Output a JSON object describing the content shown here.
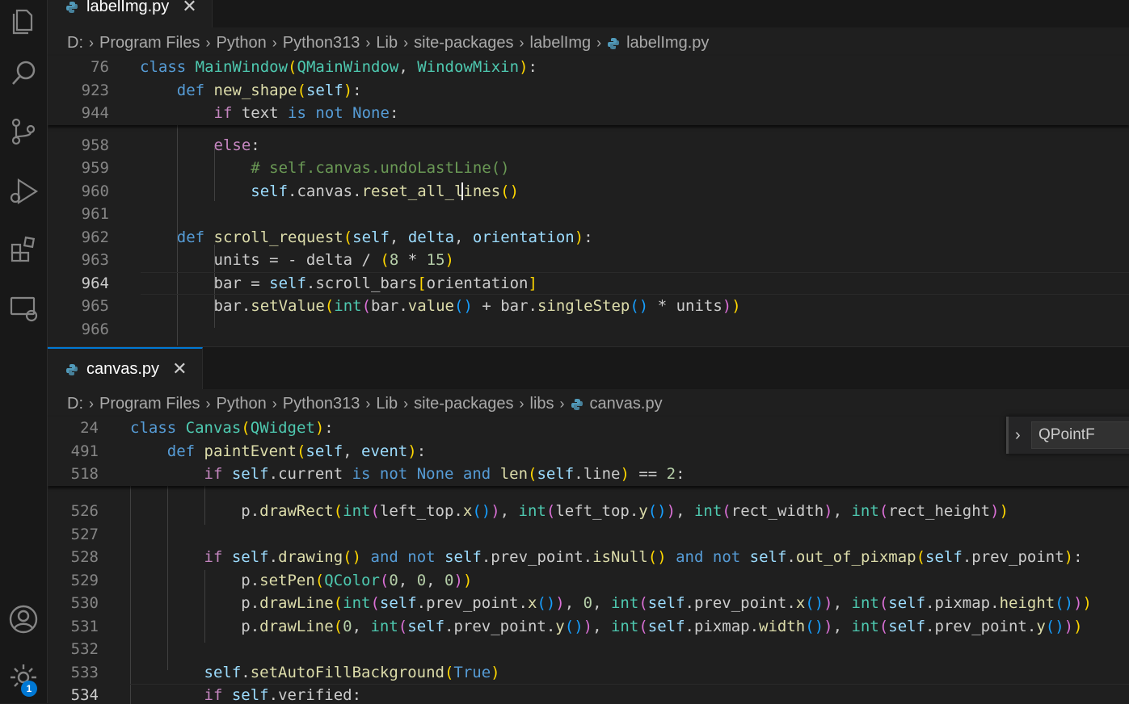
{
  "activity_bar": {
    "icons": [
      "explorer-icon",
      "search-icon",
      "source-control-icon",
      "run-debug-icon",
      "extensions-icon",
      "remote-explorer-icon",
      "accounts-icon",
      "manage-gear-icon"
    ],
    "badge": "1"
  },
  "top_pane": {
    "tab": {
      "label": "labelImg.py",
      "close": "✕"
    },
    "breadcrumb": [
      "D:",
      "Program Files",
      "Python",
      "Python313",
      "Lib",
      "site-packages",
      "labelImg",
      "labelImg.py"
    ],
    "sticky": [
      {
        "num": "76",
        "code": "class MainWindow(QMainWindow, WindowMixin):"
      },
      {
        "num": "923",
        "code": "    def new_shape(self):"
      },
      {
        "num": "944",
        "code": "        if text is not None:"
      }
    ],
    "lines": [
      {
        "num": "958",
        "code": "        else:"
      },
      {
        "num": "959",
        "code": "            # self.canvas.undoLastLine()"
      },
      {
        "num": "960",
        "code": "            self.canvas.reset_all_lines()"
      },
      {
        "num": "961",
        "code": ""
      },
      {
        "num": "962",
        "code": "    def scroll_request(self, delta, orientation):"
      },
      {
        "num": "963",
        "code": "        units = - delta / (8 * 15)"
      },
      {
        "num": "964",
        "code": "        bar = self.scroll_bars[orientation]"
      },
      {
        "num": "965",
        "code": "        bar.setValue(int(bar.value() + bar.singleStep() * units))"
      },
      {
        "num": "966",
        "code": ""
      }
    ]
  },
  "bottom_pane": {
    "tab": {
      "label": "canvas.py",
      "close": "✕"
    },
    "breadcrumb": [
      "D:",
      "Program Files",
      "Python",
      "Python313",
      "Lib",
      "site-packages",
      "libs",
      "canvas.py"
    ],
    "find_widget": {
      "value": "QPointF"
    },
    "sticky": [
      {
        "num": "24",
        "code": "class Canvas(QWidget):"
      },
      {
        "num": "491",
        "code": "    def paintEvent(self, event):"
      },
      {
        "num": "518",
        "code": "        if self.current is not None and len(self.line) == 2:"
      }
    ],
    "lines": [
      {
        "num": "526",
        "code": "            p.drawRect(int(left_top.x()), int(left_top.y()), int(rect_width), int(rect_height))"
      },
      {
        "num": "527",
        "code": ""
      },
      {
        "num": "528",
        "code": "        if self.drawing() and not self.prev_point.isNull() and not self.out_of_pixmap(self.prev_point):"
      },
      {
        "num": "529",
        "code": "            p.setPen(QColor(0, 0, 0))"
      },
      {
        "num": "530",
        "code": "            p.drawLine(int(self.prev_point.x()), 0, int(self.prev_point.x()), int(self.pixmap.height()))"
      },
      {
        "num": "531",
        "code": "            p.drawLine(0, int(self.prev_point.y()), int(self.pixmap.width()), int(self.prev_point.y()))"
      },
      {
        "num": "532",
        "code": ""
      },
      {
        "num": "533",
        "code": "        self.setAutoFillBackground(True)"
      },
      {
        "num": "534",
        "code": "        if self.verified:"
      }
    ]
  }
}
